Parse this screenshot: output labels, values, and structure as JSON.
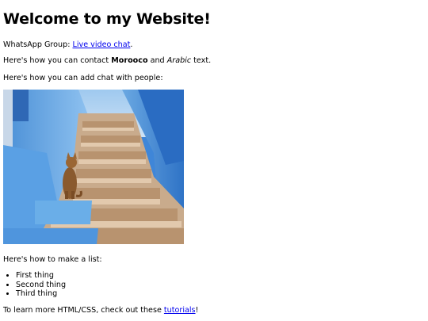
{
  "header": {
    "title": "Welcome to my Website!"
  },
  "whatsapp": {
    "prefix": "WhatsApp Group: ",
    "link_text": "Live video chat",
    "suffix": "."
  },
  "contact": {
    "prefix": "Here's how you can contact ",
    "bold": "Morooco",
    "mid": " and ",
    "italic": "Arabic",
    "suffix": " text."
  },
  "chat_line": "Here's how you can add chat with people:",
  "list_intro": "Here's how to make a list:",
  "list_items": [
    "First thing",
    "Second thing",
    "Third thing"
  ],
  "footer": {
    "prefix": "To learn more HTML/CSS, check out these ",
    "link_text": "tutorials",
    "suffix": "!"
  },
  "colors": {
    "link": "#0000ee",
    "text": "#000000",
    "background": "#ffffff"
  }
}
